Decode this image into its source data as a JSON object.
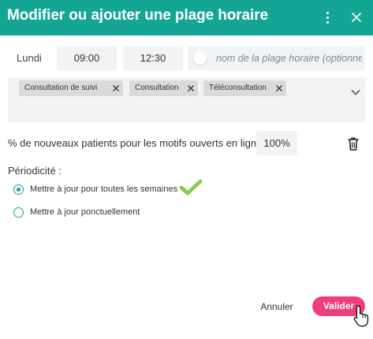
{
  "dialog": {
    "title": "Modifier ou ajouter une plage horaire",
    "header_color": "#15a595",
    "menu_icon": "kebab-menu-icon",
    "close_icon": "close-icon"
  },
  "slot": {
    "day": "Lundi",
    "start_time": "09:00",
    "end_time": "12:30",
    "name_placeholder": "nom de la plage horaire (optionnel)",
    "toggle_on": false
  },
  "motifs": {
    "tags": [
      {
        "label": "Consultation de suivi"
      },
      {
        "label": "Consultation"
      },
      {
        "label": "Téléconsultation"
      }
    ],
    "dropdown_icon": "chevron-down-icon"
  },
  "new_patients": {
    "label": "% de nouveaux patients pour les motifs ouverts en ligne :",
    "value": "100%",
    "delete_icon": "trash-icon"
  },
  "periodicity": {
    "label": "Périodicité :",
    "options": [
      {
        "label": "Mettre à jour pour toutes les semaines",
        "checked": true
      },
      {
        "label": "Mettre à jour ponctuellement",
        "checked": false
      }
    ],
    "accent_color": "#15a595"
  },
  "footer": {
    "cancel_label": "Annuler",
    "validate_label": "Valider",
    "validate_color": "#ef3f78"
  }
}
